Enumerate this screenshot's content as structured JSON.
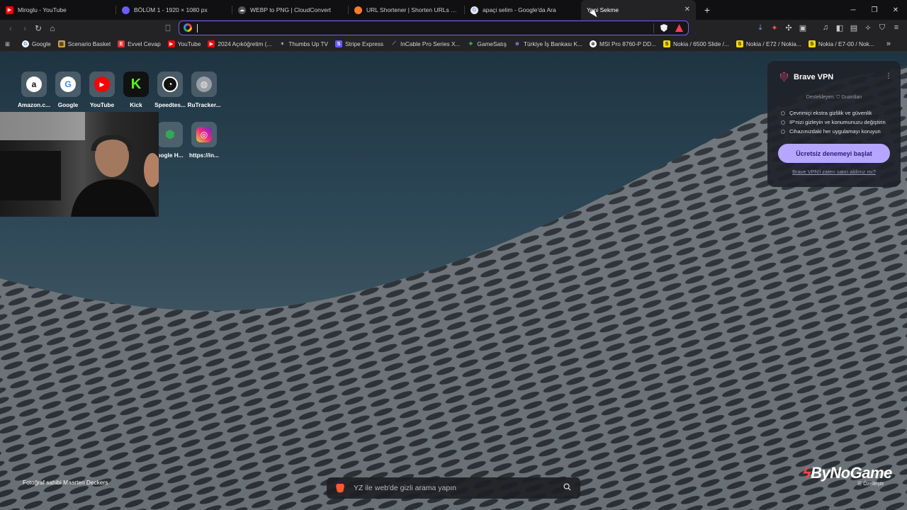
{
  "tabs": [
    {
      "title": "Miroglu - YouTube",
      "favicon_color": "#ff0000"
    },
    {
      "title": "BÖLÜM 1 - 1920 × 1080 px",
      "favicon_color": "#6b5cff"
    },
    {
      "title": "WEBP to PNG | CloudConvert",
      "favicon_color": "#888888"
    },
    {
      "title": "URL Shortener | Shorten URLs with a",
      "favicon_color": "#ff7a2b"
    },
    {
      "title": "apaçi selim - Google'da Ara",
      "favicon_color": "#cccccc"
    },
    {
      "title": "Yeni Sekme",
      "favicon_color": ""
    }
  ],
  "new_tab_symbol": "+",
  "window": {
    "minimize": "─",
    "restore": "❐",
    "close": "✕"
  },
  "address_bar": {
    "value": "",
    "accent": "#7a5cf5"
  },
  "bookmarks": [
    {
      "label": "Google",
      "color": "#ffffff",
      "glyph": "G"
    },
    {
      "label": "Scenario Basket",
      "color": "#c8a24a",
      "glyph": "▦"
    },
    {
      "label": "Evvel Cevap",
      "color": "#e03131",
      "glyph": "E"
    },
    {
      "label": "YouTube",
      "color": "#ff0000",
      "glyph": "▶"
    },
    {
      "label": "2024 Açıköğretim (...",
      "color": "#ff0000",
      "glyph": "▶"
    },
    {
      "label": "Thumbs Up TV",
      "color": "#c8d0ff",
      "glyph": "✶"
    },
    {
      "label": "Stripe Express",
      "color": "#635bff",
      "glyph": "S"
    },
    {
      "label": "InCable Pro Series X...",
      "color": "#6aa0ff",
      "glyph": "⟋"
    },
    {
      "label": "GameSatış",
      "color": "#3fbf5a",
      "glyph": "✚"
    },
    {
      "label": "Türkiye İş Bankası K...",
      "color": "#8aa4ff",
      "glyph": "⊕"
    },
    {
      "label": "MSI Pro 8760-P DD...",
      "color": "#ffffff",
      "glyph": "⊗"
    },
    {
      "label": "Nokia / 6500 Slide /...",
      "color": "#f5d90a",
      "glyph": "S"
    },
    {
      "label": "Nokia / E72 / Nokia...",
      "color": "#f5d90a",
      "glyph": "S"
    },
    {
      "label": "Nokia / E7-00 / Nok...",
      "color": "#f5d90a",
      "glyph": "S"
    }
  ],
  "bookmarks_overflow": "»",
  "speed_dial": [
    {
      "label": "Amazon.c...",
      "icon": "amazon-icon"
    },
    {
      "label": "Google",
      "icon": "google-icon"
    },
    {
      "label": "YouTube",
      "icon": "youtube-icon"
    },
    {
      "label": "Kick",
      "icon": "kick-icon"
    },
    {
      "label": "Speedtes...",
      "icon": "speedtest-icon"
    },
    {
      "label": "RuTracker...",
      "icon": "globe-icon"
    },
    {
      "label": "oogle H...",
      "icon": "google-maps-icon"
    },
    {
      "label": "https://in...",
      "icon": "instagram-icon"
    }
  ],
  "vpn": {
    "title": "Brave VPN",
    "menu": "⋮",
    "supported_by": "Destekleyen:",
    "partner": "Guardian",
    "features": [
      "Çevrimiçi ekstra gizlilik ve güvenlik",
      "IP'nizi gizleyin ve konumunuzu değiştirin",
      "Cihazınızdaki her uygulamayı koruyun"
    ],
    "cta": "Ücretsiz denemeyi başlat",
    "link": "Brave VPN'i zaten satın aldınız mı?"
  },
  "photo_credit": "Fotoğraf sahibi Maarten Deckers",
  "search": {
    "placeholder": "YZ ile web'de gizli arama yapın"
  },
  "watermark": {
    "brand_prefix": "By",
    "brand_main": "NoGame",
    "customize": "Özelleştir"
  }
}
